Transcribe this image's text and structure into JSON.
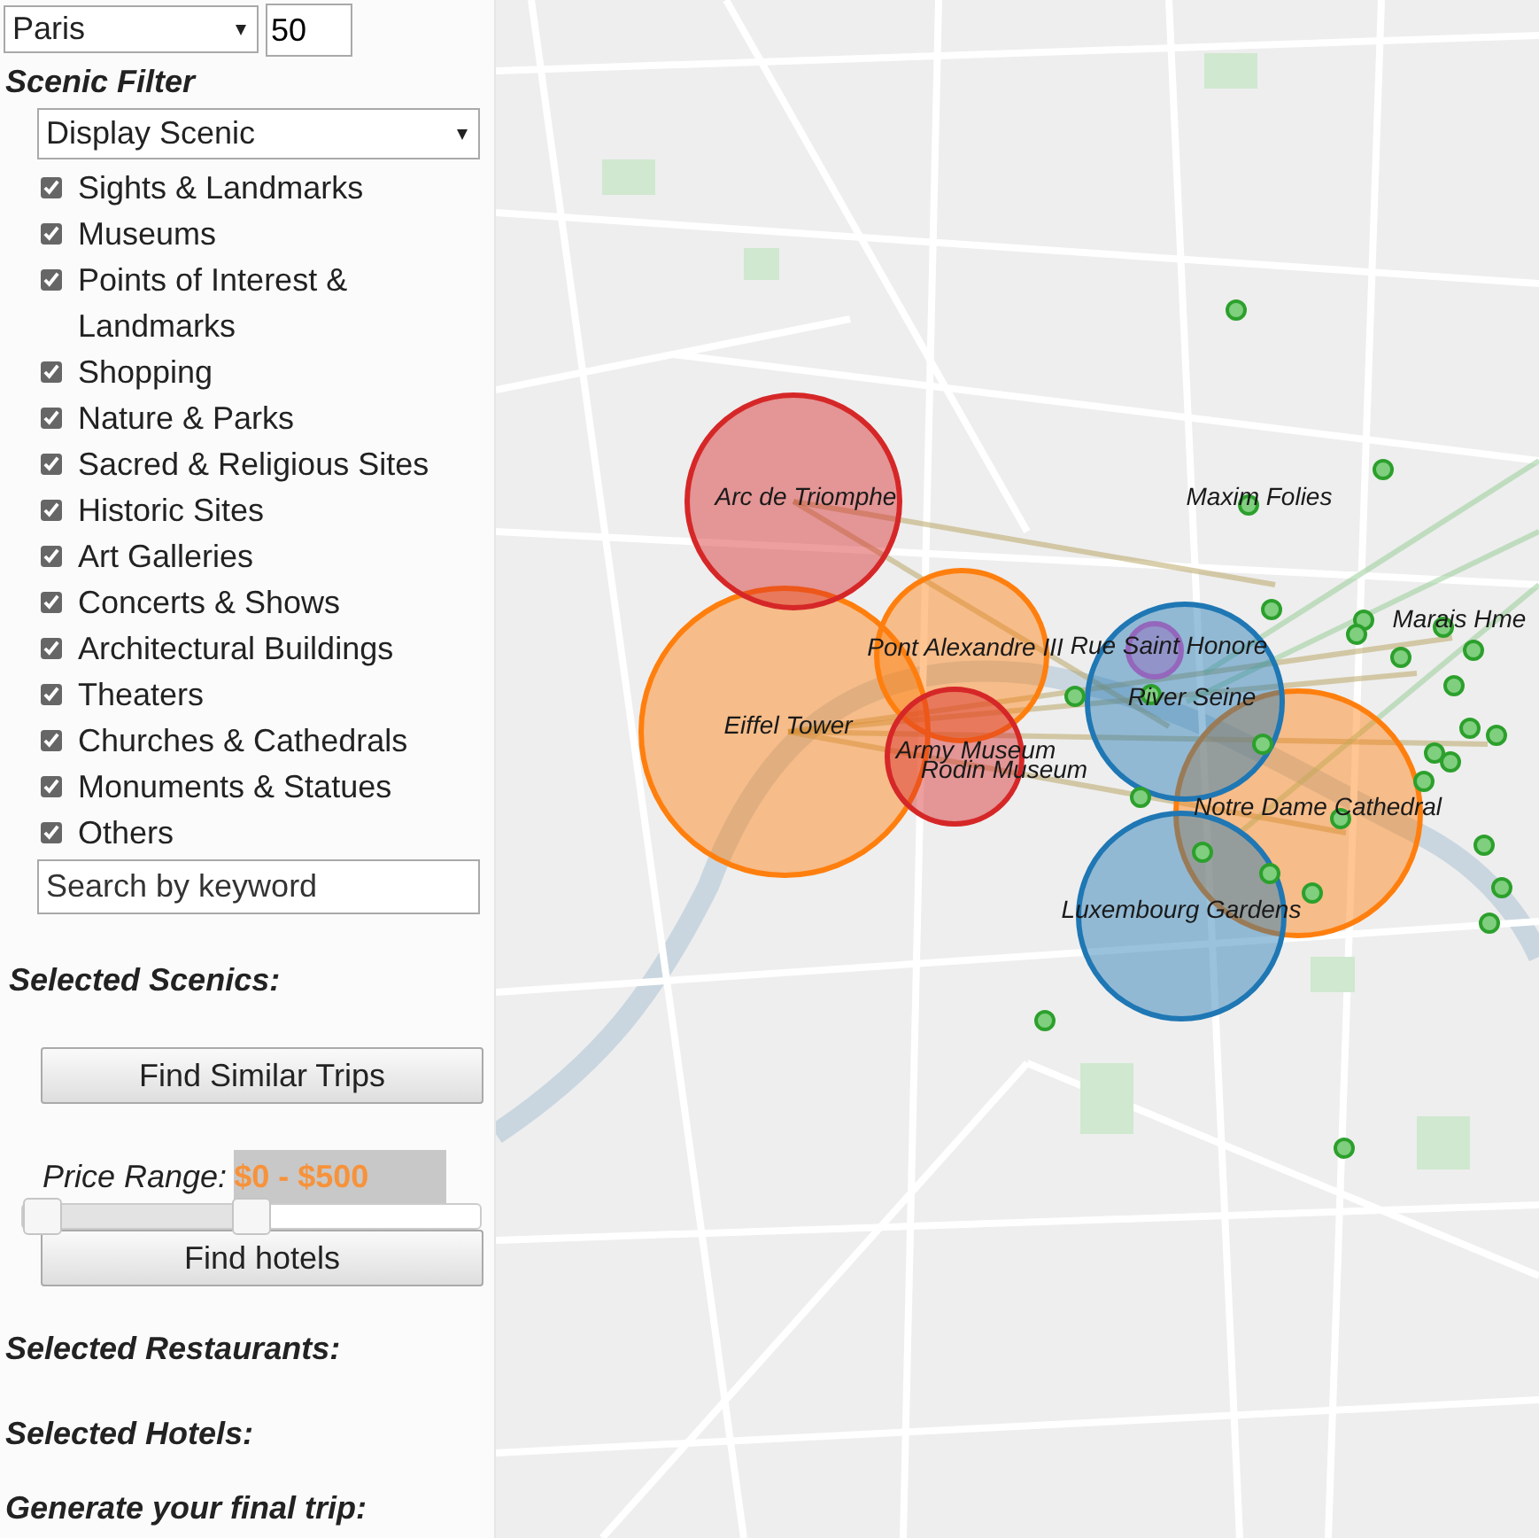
{
  "panel": {
    "city_select": {
      "value": "Paris"
    },
    "radius_field": {
      "value": "50"
    },
    "scenic_filter": {
      "title": "Scenic Filter",
      "display_select": {
        "value": "Display Scenic"
      },
      "categories": [
        {
          "label": "Sights & Landmarks",
          "checked": true
        },
        {
          "label": "Museums",
          "checked": true
        },
        {
          "label": "Points of Interest & Landmarks",
          "checked": true
        },
        {
          "label": "Shopping",
          "checked": true
        },
        {
          "label": "Nature & Parks",
          "checked": true
        },
        {
          "label": "Sacred & Religious Sites",
          "checked": true
        },
        {
          "label": "Historic Sites",
          "checked": true
        },
        {
          "label": "Art Galleries",
          "checked": true
        },
        {
          "label": "Concerts & Shows",
          "checked": true
        },
        {
          "label": "Architectural Buildings",
          "checked": true
        },
        {
          "label": "Theaters",
          "checked": true
        },
        {
          "label": "Churches & Cathedrals",
          "checked": true
        },
        {
          "label": "Monuments & Statues",
          "checked": true
        },
        {
          "label": "Others",
          "checked": true
        }
      ],
      "search": {
        "placeholder": "Search by keyword"
      }
    },
    "selected_scenics": {
      "title": "Selected Scenics:"
    },
    "find_similar_button": "Find Similar Trips",
    "price_range": {
      "label": "Price Range:",
      "value": "$0 - $500",
      "level": 0.5
    },
    "find_hotels_button": "Find hotels",
    "selected_restaurants": {
      "title": "Selected Restaurants:"
    },
    "selected_hotels": {
      "title": "Selected Hotels:"
    },
    "final_trip": {
      "title": "Generate your final trip:"
    }
  },
  "map": {
    "markers": [
      {
        "kind": "circle",
        "label": "Arc de Triomphe",
        "color": "#d62728"
      },
      {
        "kind": "label",
        "label": "Maxim Folies"
      },
      {
        "kind": "circle",
        "label": "Pont Alexandre III",
        "color": "#ff7f0e"
      },
      {
        "kind": "circle",
        "label": "Rue Saint Honore",
        "color": "#9467bd"
      },
      {
        "kind": "label",
        "label": "Marais Hme"
      },
      {
        "kind": "circle",
        "label": "River Seine",
        "color": "#1f77b4"
      },
      {
        "kind": "circle",
        "label": "Eiffel Tower",
        "color": "#ff7f0e"
      },
      {
        "kind": "circle",
        "label": "Army Museum",
        "color": "#d62728"
      },
      {
        "kind": "label",
        "label": "Rodin Museum"
      },
      {
        "kind": "circle",
        "label": "Notre Dame Cathedral",
        "color": "#ff7f0e"
      },
      {
        "kind": "circle",
        "label": "Luxembourg Gardens",
        "color": "#1f77b4"
      }
    ]
  }
}
